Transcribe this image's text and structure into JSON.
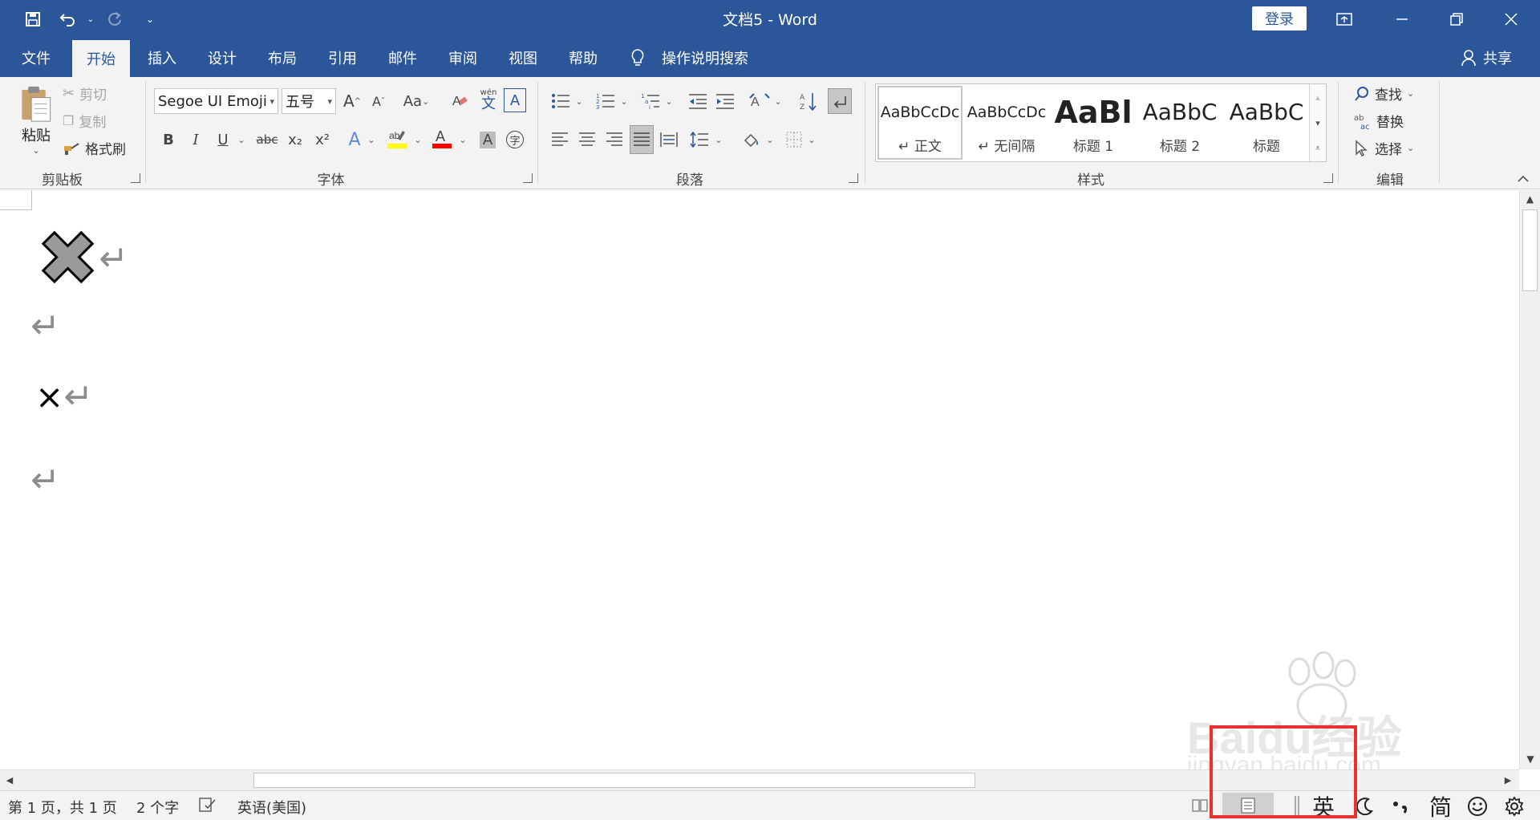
{
  "window": {
    "title": "文档5 - Word",
    "login_label": "登录"
  },
  "tabs": [
    "文件",
    "开始",
    "插入",
    "设计",
    "布局",
    "引用",
    "邮件",
    "审阅",
    "视图",
    "帮助"
  ],
  "tell_me": "操作说明搜索",
  "share_label": "共享",
  "clipboard": {
    "paste_label": "粘贴",
    "cut_label": "剪切",
    "copy_label": "复制",
    "painter_label": "格式刷",
    "group_label": "剪贴板"
  },
  "font": {
    "name": "Segoe UI Emoji",
    "size": "五号",
    "group_label": "字体",
    "bold": "B",
    "italic": "I",
    "underline": "U",
    "strike": "abc",
    "sub": "x₂",
    "sup": "x²",
    "grow": "A",
    "shrink": "A",
    "case": "Aa",
    "phonetic": "wén",
    "phonetic_char": "文",
    "border_char": "A",
    "enclose_char": "字"
  },
  "paragraph": {
    "group_label": "段落"
  },
  "styles": {
    "group_label": "样式",
    "items": [
      {
        "preview": "AaBbCcDc",
        "name": "正文"
      },
      {
        "preview": "AaBbCcDc",
        "name": "无间隔"
      },
      {
        "preview": "AaBl",
        "name": "标题 1"
      },
      {
        "preview": "AaBbC",
        "name": "标题 2"
      },
      {
        "preview": "AaBbC",
        "name": "标题"
      }
    ]
  },
  "editing": {
    "find_label": "查找",
    "replace_label": "替换",
    "select_label": "选择",
    "group_label": "编辑"
  },
  "document": {
    "lines": [
      "✖",
      "",
      "×",
      ""
    ]
  },
  "status": {
    "page": "第 1 页，共 1 页",
    "words": "2 个字",
    "language": "英语(美国)"
  },
  "ime": {
    "mode": "英",
    "simplified": "简"
  },
  "watermark": {
    "logo": "Baidu经验",
    "url": "jingyan.baidu.com"
  },
  "colors": {
    "brand": "#2b579a",
    "highlight": "#ffff00",
    "font_color": "#ff0000",
    "annotation": "#e8322f"
  }
}
